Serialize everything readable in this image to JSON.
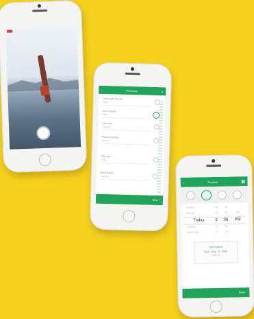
{
  "phone2": {
    "header_title": "Promises",
    "rows": [
      {
        "title": "Lunch with friends",
        "sub": "Today"
      },
      {
        "title": "Gym session",
        "sub": "Today"
      },
      {
        "title": "Call mom",
        "sub": "Tomorrow"
      },
      {
        "title": "Project meeting",
        "sub": "Tomorrow"
      },
      {
        "title": "Pay rent",
        "sub": "Friday"
      },
      {
        "title": "Book flights",
        "sub": "Saturday"
      }
    ],
    "footer_btn": "New +"
  },
  "phone3": {
    "header_title": "Promise",
    "picker": {
      "rows": [
        {
          "day": "Sunday",
          "h": "11",
          "m": "55",
          "ap": ""
        },
        {
          "day": "Monday",
          "h": "12",
          "m": "00",
          "ap": "AM"
        },
        {
          "day": "Today",
          "h": "2",
          "m": "00",
          "ap": "PM"
        },
        {
          "day": "Tuesday",
          "h": "1",
          "m": "05",
          "ap": ""
        },
        {
          "day": "Wednesday",
          "h": "2",
          "m": "10",
          "ap": ""
        }
      ]
    },
    "card_label": "Due in about",
    "card_date": "Mon, May 12, 2014",
    "card_sub": "5:00 PM",
    "footer_btn": "Done"
  }
}
